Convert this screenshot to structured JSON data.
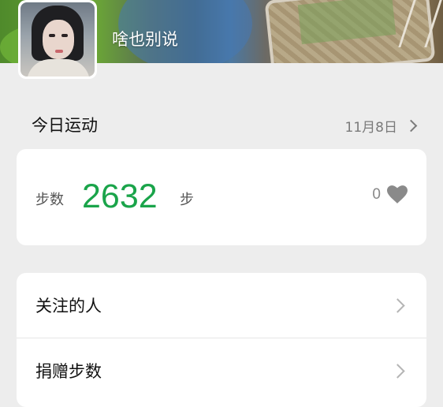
{
  "profile": {
    "username": "啥也别说"
  },
  "today": {
    "title": "今日运动",
    "date": "11月8日",
    "steps_label": "步数",
    "steps_value": "2632",
    "steps_unit": "步",
    "likes_count": "0"
  },
  "menu": {
    "items": [
      {
        "label": "关注的人"
      },
      {
        "label": "捐赠步数"
      }
    ]
  },
  "colors": {
    "accent_green": "#1aa44a",
    "background": "#ededed"
  },
  "icons": {
    "chevron": "chevron-right-icon",
    "heart": "heart-icon"
  }
}
